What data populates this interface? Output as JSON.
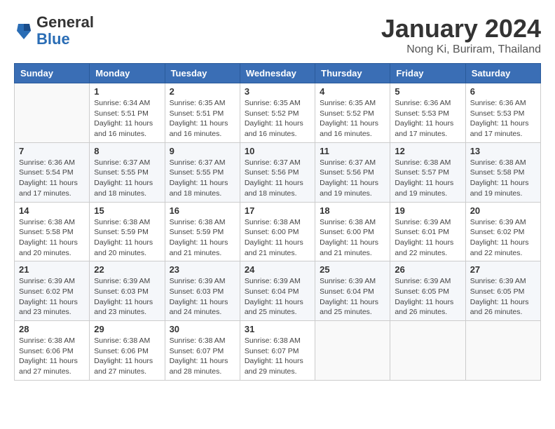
{
  "header": {
    "logo": {
      "general": "General",
      "blue": "Blue"
    },
    "title": "January 2024",
    "location": "Nong Ki, Buriram, Thailand"
  },
  "calendar": {
    "days_of_week": [
      "Sunday",
      "Monday",
      "Tuesday",
      "Wednesday",
      "Thursday",
      "Friday",
      "Saturday"
    ],
    "weeks": [
      [
        {
          "day": "",
          "info": ""
        },
        {
          "day": "1",
          "info": "Sunrise: 6:34 AM\nSunset: 5:51 PM\nDaylight: 11 hours and 16 minutes."
        },
        {
          "day": "2",
          "info": "Sunrise: 6:35 AM\nSunset: 5:51 PM\nDaylight: 11 hours and 16 minutes."
        },
        {
          "day": "3",
          "info": "Sunrise: 6:35 AM\nSunset: 5:52 PM\nDaylight: 11 hours and 16 minutes."
        },
        {
          "day": "4",
          "info": "Sunrise: 6:35 AM\nSunset: 5:52 PM\nDaylight: 11 hours and 16 minutes."
        },
        {
          "day": "5",
          "info": "Sunrise: 6:36 AM\nSunset: 5:53 PM\nDaylight: 11 hours and 17 minutes."
        },
        {
          "day": "6",
          "info": "Sunrise: 6:36 AM\nSunset: 5:53 PM\nDaylight: 11 hours and 17 minutes."
        }
      ],
      [
        {
          "day": "7",
          "info": "Sunrise: 6:36 AM\nSunset: 5:54 PM\nDaylight: 11 hours and 17 minutes."
        },
        {
          "day": "8",
          "info": "Sunrise: 6:37 AM\nSunset: 5:55 PM\nDaylight: 11 hours and 18 minutes."
        },
        {
          "day": "9",
          "info": "Sunrise: 6:37 AM\nSunset: 5:55 PM\nDaylight: 11 hours and 18 minutes."
        },
        {
          "day": "10",
          "info": "Sunrise: 6:37 AM\nSunset: 5:56 PM\nDaylight: 11 hours and 18 minutes."
        },
        {
          "day": "11",
          "info": "Sunrise: 6:37 AM\nSunset: 5:56 PM\nDaylight: 11 hours and 19 minutes."
        },
        {
          "day": "12",
          "info": "Sunrise: 6:38 AM\nSunset: 5:57 PM\nDaylight: 11 hours and 19 minutes."
        },
        {
          "day": "13",
          "info": "Sunrise: 6:38 AM\nSunset: 5:58 PM\nDaylight: 11 hours and 19 minutes."
        }
      ],
      [
        {
          "day": "14",
          "info": "Sunrise: 6:38 AM\nSunset: 5:58 PM\nDaylight: 11 hours and 20 minutes."
        },
        {
          "day": "15",
          "info": "Sunrise: 6:38 AM\nSunset: 5:59 PM\nDaylight: 11 hours and 20 minutes."
        },
        {
          "day": "16",
          "info": "Sunrise: 6:38 AM\nSunset: 5:59 PM\nDaylight: 11 hours and 21 minutes."
        },
        {
          "day": "17",
          "info": "Sunrise: 6:38 AM\nSunset: 6:00 PM\nDaylight: 11 hours and 21 minutes."
        },
        {
          "day": "18",
          "info": "Sunrise: 6:38 AM\nSunset: 6:00 PM\nDaylight: 11 hours and 21 minutes."
        },
        {
          "day": "19",
          "info": "Sunrise: 6:39 AM\nSunset: 6:01 PM\nDaylight: 11 hours and 22 minutes."
        },
        {
          "day": "20",
          "info": "Sunrise: 6:39 AM\nSunset: 6:02 PM\nDaylight: 11 hours and 22 minutes."
        }
      ],
      [
        {
          "day": "21",
          "info": "Sunrise: 6:39 AM\nSunset: 6:02 PM\nDaylight: 11 hours and 23 minutes."
        },
        {
          "day": "22",
          "info": "Sunrise: 6:39 AM\nSunset: 6:03 PM\nDaylight: 11 hours and 23 minutes."
        },
        {
          "day": "23",
          "info": "Sunrise: 6:39 AM\nSunset: 6:03 PM\nDaylight: 11 hours and 24 minutes."
        },
        {
          "day": "24",
          "info": "Sunrise: 6:39 AM\nSunset: 6:04 PM\nDaylight: 11 hours and 25 minutes."
        },
        {
          "day": "25",
          "info": "Sunrise: 6:39 AM\nSunset: 6:04 PM\nDaylight: 11 hours and 25 minutes."
        },
        {
          "day": "26",
          "info": "Sunrise: 6:39 AM\nSunset: 6:05 PM\nDaylight: 11 hours and 26 minutes."
        },
        {
          "day": "27",
          "info": "Sunrise: 6:39 AM\nSunset: 6:05 PM\nDaylight: 11 hours and 26 minutes."
        }
      ],
      [
        {
          "day": "28",
          "info": "Sunrise: 6:38 AM\nSunset: 6:06 PM\nDaylight: 11 hours and 27 minutes."
        },
        {
          "day": "29",
          "info": "Sunrise: 6:38 AM\nSunset: 6:06 PM\nDaylight: 11 hours and 27 minutes."
        },
        {
          "day": "30",
          "info": "Sunrise: 6:38 AM\nSunset: 6:07 PM\nDaylight: 11 hours and 28 minutes."
        },
        {
          "day": "31",
          "info": "Sunrise: 6:38 AM\nSunset: 6:07 PM\nDaylight: 11 hours and 29 minutes."
        },
        {
          "day": "",
          "info": ""
        },
        {
          "day": "",
          "info": ""
        },
        {
          "day": "",
          "info": ""
        }
      ]
    ]
  }
}
